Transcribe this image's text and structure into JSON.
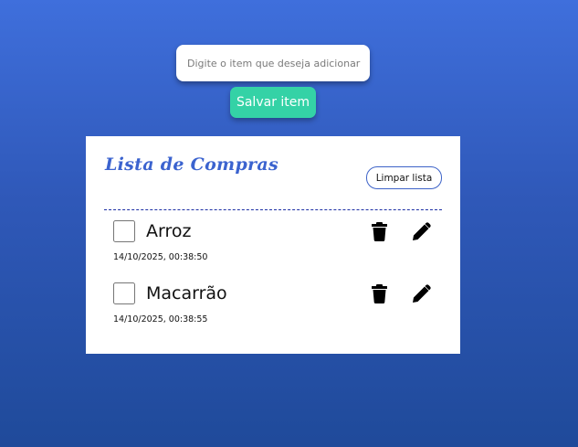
{
  "form": {
    "input_placeholder": "Digite o item que deseja adicionar",
    "input_value": "",
    "save_label": "Salvar item"
  },
  "list": {
    "title": "Lista de Compras",
    "clear_label": "Limpar lista",
    "items": [
      {
        "name": "Arroz",
        "date": "14/10/2025, 00:38:50",
        "checked": false
      },
      {
        "name": "Macarrão",
        "date": "14/10/2025, 00:38:55",
        "checked": false
      }
    ]
  },
  "icons": {
    "delete": "trash-icon",
    "edit": "pencil-icon"
  },
  "colors": {
    "background_top": "#3f6fdc",
    "background_bottom": "#1f4a9a",
    "save_button": "#34d2a6",
    "title": "#3b63cf",
    "divider": "#1d2fa5"
  }
}
